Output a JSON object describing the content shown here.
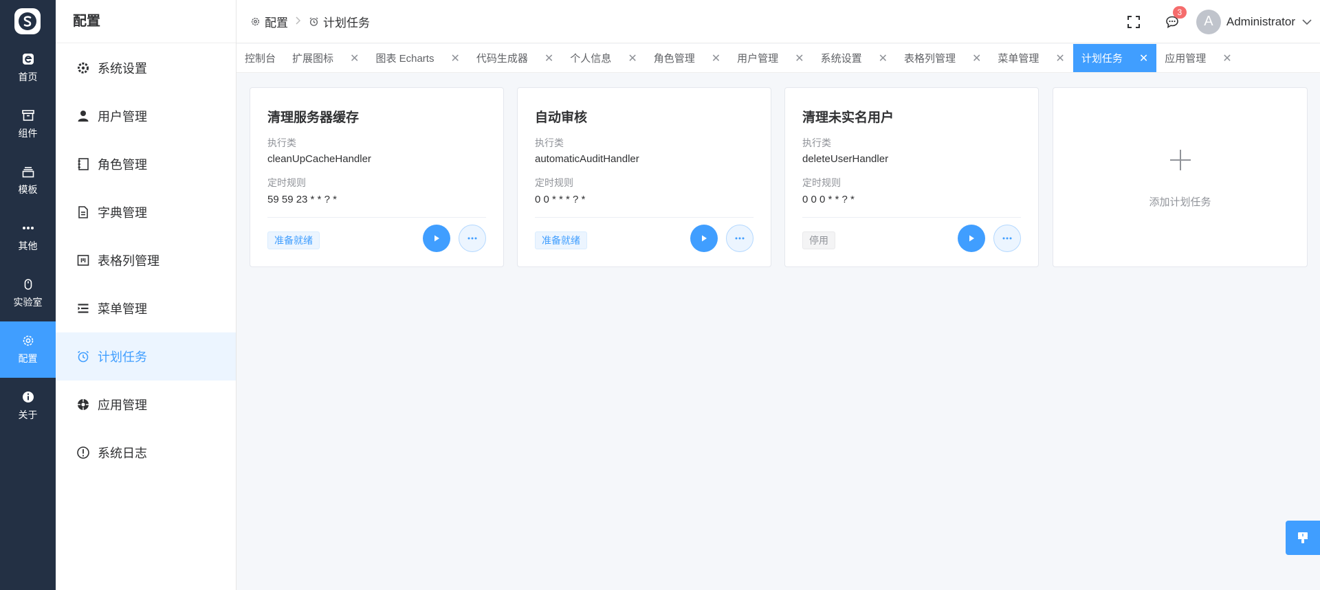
{
  "rail": {
    "items": [
      {
        "label": "首页",
        "icon": "home-icon"
      },
      {
        "label": "组件",
        "icon": "archive-icon"
      },
      {
        "label": "模板",
        "icon": "stack-icon"
      },
      {
        "label": "其他",
        "icon": "more-icon"
      },
      {
        "label": "实验室",
        "icon": "mouse-icon"
      },
      {
        "label": "配置",
        "icon": "gear-icon",
        "active": true
      },
      {
        "label": "关于",
        "icon": "info-icon"
      }
    ]
  },
  "submenu": {
    "title": "配置",
    "items": [
      {
        "label": "系统设置",
        "icon": "gear-icon"
      },
      {
        "label": "用户管理",
        "icon": "user-icon"
      },
      {
        "label": "角色管理",
        "icon": "notebook-icon"
      },
      {
        "label": "字典管理",
        "icon": "document-icon"
      },
      {
        "label": "表格列管理",
        "icon": "columns-icon"
      },
      {
        "label": "菜单管理",
        "icon": "menu-icon"
      },
      {
        "label": "计划任务",
        "icon": "alarm-clock-icon",
        "active": true
      },
      {
        "label": "应用管理",
        "icon": "app-icon"
      },
      {
        "label": "系统日志",
        "icon": "warning-circle-icon"
      }
    ]
  },
  "header": {
    "breadcrumb": [
      "配置",
      "计划任务"
    ],
    "notification_count": "3",
    "avatar_letter": "A",
    "username": "Administrator"
  },
  "tabs": [
    {
      "label": "控制台",
      "closable": false
    },
    {
      "label": "扩展图标",
      "closable": true
    },
    {
      "label": "图表 Echarts",
      "closable": true
    },
    {
      "label": "代码生成器",
      "closable": true
    },
    {
      "label": "个人信息",
      "closable": true
    },
    {
      "label": "角色管理",
      "closable": true
    },
    {
      "label": "用户管理",
      "closable": true
    },
    {
      "label": "系统设置",
      "closable": true
    },
    {
      "label": "表格列管理",
      "closable": true
    },
    {
      "label": "菜单管理",
      "closable": true
    },
    {
      "label": "计划任务",
      "closable": true,
      "active": true
    },
    {
      "label": "应用管理",
      "closable": true
    }
  ],
  "tasks": [
    {
      "title": "清理服务器缓存",
      "handler_label": "执行类",
      "handler": "cleanUpCacheHandler",
      "cron_label": "定时规则",
      "cron": "59 59 23 * * ? *",
      "status": "准备就绪",
      "status_type": "ready"
    },
    {
      "title": "自动审核",
      "handler_label": "执行类",
      "handler": "automaticAuditHandler",
      "cron_label": "定时规则",
      "cron": "0 0 * * * ? *",
      "status": "准备就绪",
      "status_type": "ready"
    },
    {
      "title": "清理未实名用户",
      "handler_label": "执行类",
      "handler": "deleteUserHandler",
      "cron_label": "定时规则",
      "cron": "0 0 0 * * ? *",
      "status": "停用",
      "status_type": "stopped"
    }
  ],
  "add_task_label": "添加计划任务",
  "colors": {
    "primary": "#409eff",
    "rail_bg": "#233044",
    "danger": "#f56c6c"
  }
}
